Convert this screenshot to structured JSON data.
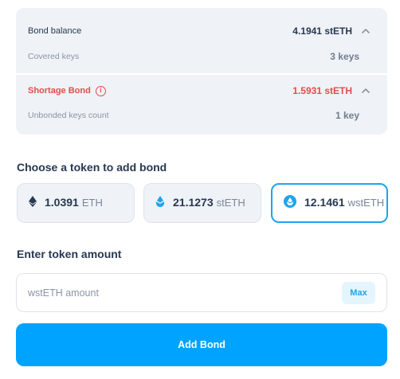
{
  "summary": {
    "bond_balance": {
      "label": "Bond balance",
      "value": "4.1941 stETH"
    },
    "covered_keys": {
      "label": "Covered keys",
      "value": "3 keys"
    },
    "shortage_bond": {
      "label": "Shortage Bond",
      "value": "1.5931 stETH"
    },
    "unbonded_keys": {
      "label": "Unbonded keys count",
      "value": "1 key"
    }
  },
  "token_section": {
    "title": "Choose a token to add bond",
    "tokens": [
      {
        "amount": "1.0391",
        "unit": "ETH",
        "icon": "eth-icon",
        "selected": false
      },
      {
        "amount": "21.1273",
        "unit": "stETH",
        "icon": "steth-icon",
        "selected": false
      },
      {
        "amount": "12.1461",
        "unit": "wstETH",
        "icon": "wsteth-icon",
        "selected": true
      }
    ]
  },
  "amount_section": {
    "title": "Enter token amount",
    "placeholder": "wstETH amount",
    "max_label": "Max"
  },
  "submit_label": "Add Bond",
  "colors": {
    "accent": "#00a3ff",
    "warning": "#e14d4d",
    "panel": "#eff2f6",
    "text": "#273852"
  }
}
